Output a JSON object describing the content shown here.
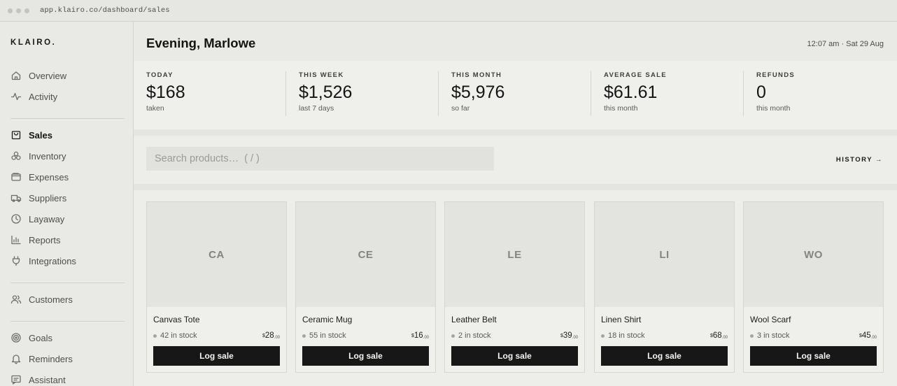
{
  "browser": {
    "url": "app.klairo.co/dashboard/sales"
  },
  "sidebar": {
    "brand": "KLAIRO.",
    "items": [
      {
        "label": "Overview",
        "icon": "home-icon"
      },
      {
        "label": "Activity",
        "icon": "pulse-icon"
      },
      {
        "label": "Sales",
        "icon": "bag-icon",
        "active": true
      },
      {
        "label": "Inventory",
        "icon": "boxes-icon"
      },
      {
        "label": "Expenses",
        "icon": "wallet-icon"
      },
      {
        "label": "Suppliers",
        "icon": "truck-icon"
      },
      {
        "label": "Layaway",
        "icon": "clock-icon"
      },
      {
        "label": "Reports",
        "icon": "bar-chart-icon"
      },
      {
        "label": "Integrations",
        "icon": "plug-icon"
      },
      {
        "label": "Customers",
        "icon": "users-icon"
      },
      {
        "label": "Goals",
        "icon": "target-icon"
      },
      {
        "label": "Reminders",
        "icon": "bell-icon"
      },
      {
        "label": "Assistant",
        "icon": "chat-icon"
      }
    ]
  },
  "header": {
    "greeting": "Evening, Marlowe",
    "datetime": "12:07 am · Sat 29 Aug"
  },
  "stats": [
    {
      "label": "TODAY",
      "value": "$168",
      "sub": "taken"
    },
    {
      "label": "THIS WEEK",
      "value": "$1,526",
      "sub": "last 7 days"
    },
    {
      "label": "THIS MONTH",
      "value": "$5,976",
      "sub": "so far"
    },
    {
      "label": "AVERAGE SALE",
      "value": "$61.61",
      "sub": "this month"
    },
    {
      "label": "REFUNDS",
      "value": "0",
      "sub": "this month"
    }
  ],
  "search": {
    "placeholder": "Search products…  ( / )",
    "history_label": "HISTORY →"
  },
  "products": [
    {
      "initials": "CA",
      "name": "Canvas Tote",
      "stock": "42 in stock",
      "currency": "$",
      "price_whole": "28",
      "price_cents": ".00",
      "action": "Log sale"
    },
    {
      "initials": "CE",
      "name": "Ceramic Mug",
      "stock": "55 in stock",
      "currency": "$",
      "price_whole": "16",
      "price_cents": ".00",
      "action": "Log sale"
    },
    {
      "initials": "LE",
      "name": "Leather Belt",
      "stock": "2 in stock",
      "currency": "$",
      "price_whole": "39",
      "price_cents": ".00",
      "action": "Log sale"
    },
    {
      "initials": "LI",
      "name": "Linen Shirt",
      "stock": "18 in stock",
      "currency": "$",
      "price_whole": "68",
      "price_cents": ".00",
      "action": "Log sale"
    },
    {
      "initials": "WO",
      "name": "Wool Scarf",
      "stock": "3 in stock",
      "currency": "$",
      "price_whole": "45",
      "price_cents": ".00",
      "action": "Log sale"
    }
  ]
}
